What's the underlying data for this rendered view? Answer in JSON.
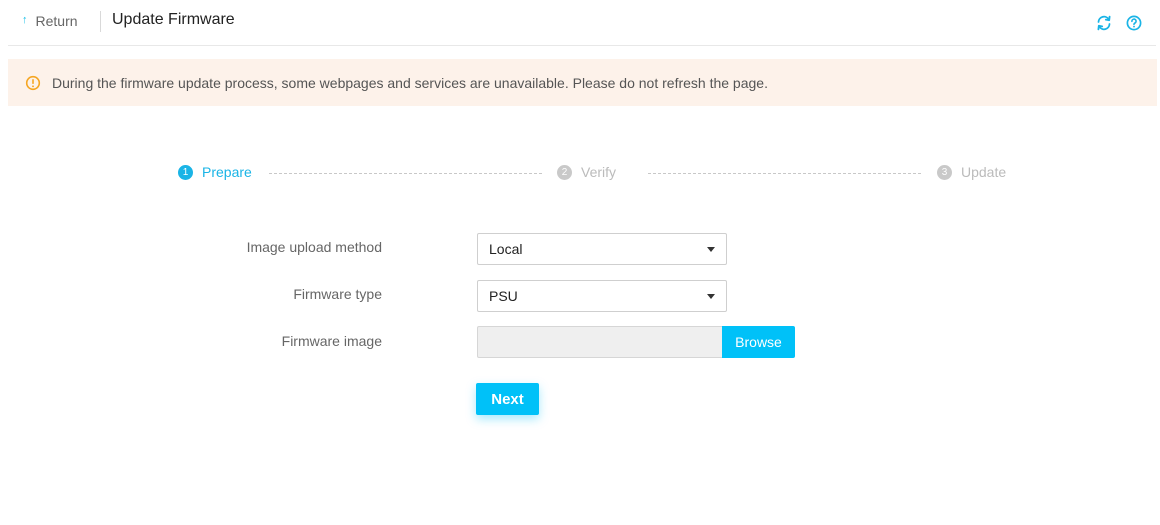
{
  "header": {
    "return_label": "Return",
    "title": "Update Firmware",
    "icons": [
      "refresh-icon",
      "help-icon"
    ]
  },
  "notice": {
    "icon": "warning-icon",
    "text": "During the firmware update process, some webpages and services are unavailable. Please do not refresh the page."
  },
  "steps": [
    {
      "num": "1",
      "label": "Prepare",
      "state": "active"
    },
    {
      "num": "2",
      "label": "Verify",
      "state": "inactive"
    },
    {
      "num": "3",
      "label": "Update",
      "state": "inactive"
    }
  ],
  "form": {
    "upload_method": {
      "label": "Image upload method",
      "value": "Local"
    },
    "firmware_type": {
      "label": "Firmware type",
      "value": "PSU"
    },
    "firmware_image": {
      "label": "Firmware image",
      "value": "",
      "browse_label": "Browse"
    },
    "next_label": "Next"
  },
  "colors": {
    "accent": "#00c1f8",
    "notice_bg": "#fdf2ea",
    "warning": "#f5a623"
  }
}
